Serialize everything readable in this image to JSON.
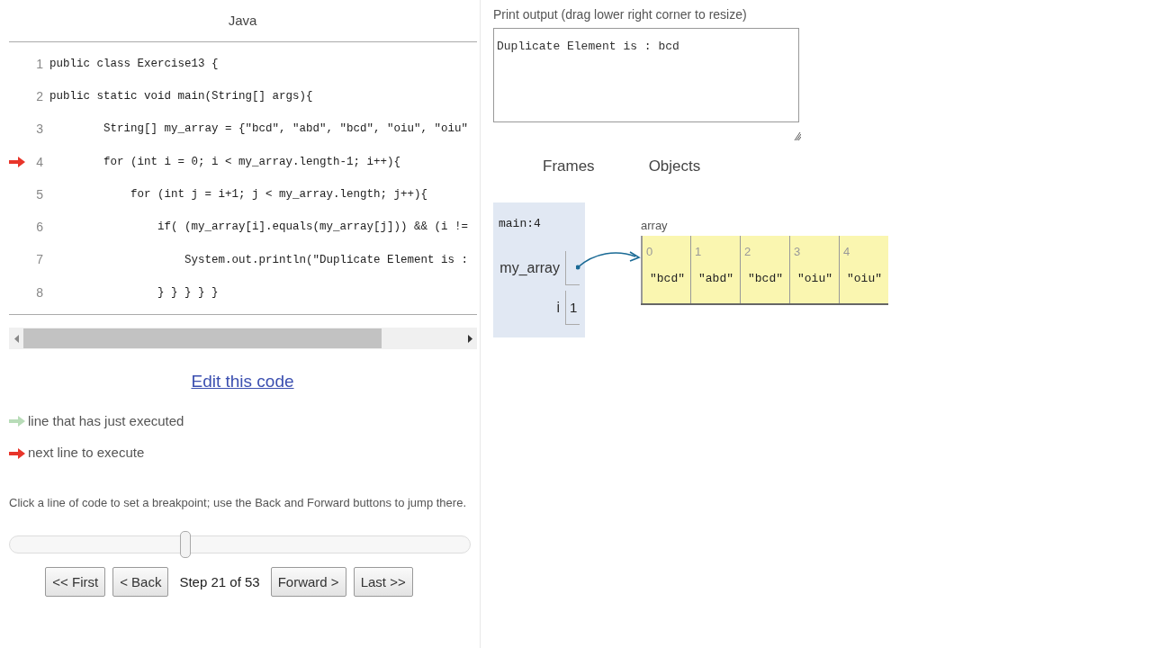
{
  "language": "Java",
  "code_lines": [
    {
      "number": "1",
      "text": "public class Exercise13 {",
      "next_line": false
    },
    {
      "number": "2",
      "text": "public static void main(String[] args){",
      "next_line": false
    },
    {
      "number": "3",
      "text": "        String[] my_array = {\"bcd\", \"abd\", \"bcd\", \"oiu\", \"oiu\"",
      "next_line": false
    },
    {
      "number": "4",
      "text": "        for (int i = 0; i < my_array.length-1; i++){",
      "next_line": true
    },
    {
      "number": "5",
      "text": "            for (int j = i+1; j < my_array.length; j++){",
      "next_line": false
    },
    {
      "number": "6",
      "text": "                if( (my_array[i].equals(my_array[j])) && (i !=",
      "next_line": false
    },
    {
      "number": "7",
      "text": "                    System.out.println(\"Duplicate Element is :",
      "next_line": false
    },
    {
      "number": "8",
      "text": "                } } } } }",
      "next_line": false
    }
  ],
  "edit_link": "Edit this code",
  "legend": [
    {
      "text": "line that has just executed",
      "color": "#b8dcb8"
    },
    {
      "text": "next line to execute",
      "color": "#e8352a"
    }
  ],
  "hint": "Click a line of code to set a breakpoint; use the Back and Forward buttons to jump there.",
  "step_slider": {
    "level": 0.38
  },
  "nav": {
    "first": "<< First",
    "back": "< Back",
    "step": "Step 21 of 53",
    "forward": "Forward >",
    "last": "Last >>"
  },
  "output": {
    "label": "Print output (drag lower right corner to resize)",
    "text": "Duplicate Element is : bcd"
  },
  "frames_heading": "Frames",
  "objects_heading": "Objects",
  "frame": {
    "name": "main:4",
    "vars": [
      {
        "name": "my_array",
        "kind": "pointer"
      },
      {
        "name": "i",
        "kind": "value",
        "value": "1"
      }
    ]
  },
  "array": {
    "label": "array",
    "cells": [
      {
        "index": "0",
        "value": "\"bcd\""
      },
      {
        "index": "1",
        "value": "\"abd\""
      },
      {
        "index": "2",
        "value": "\"bcd\""
      },
      {
        "index": "3",
        "value": "\"oiu\""
      },
      {
        "index": "4",
        "value": "\"oiu\""
      }
    ]
  }
}
